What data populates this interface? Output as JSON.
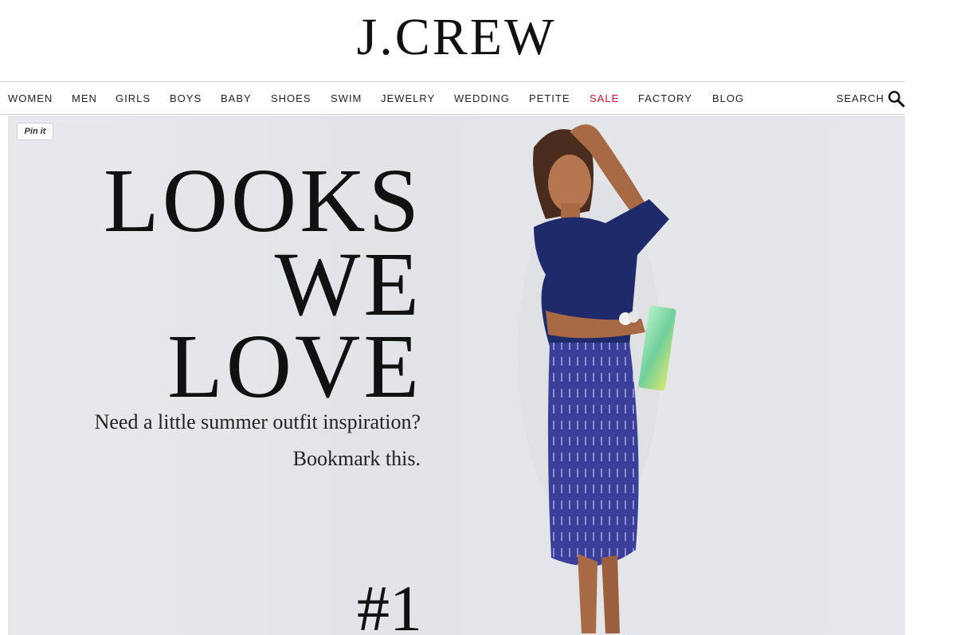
{
  "brand": {
    "logo_text": "J.CREW"
  },
  "nav": {
    "items": [
      {
        "label": "WOMEN"
      },
      {
        "label": "MEN"
      },
      {
        "label": "GIRLS"
      },
      {
        "label": "BOYS"
      },
      {
        "label": "BABY"
      },
      {
        "label": "SHOES"
      },
      {
        "label": "SWIM"
      },
      {
        "label": "JEWELRY"
      },
      {
        "label": "WEDDING"
      },
      {
        "label": "PETITE"
      },
      {
        "label": "SALE"
      },
      {
        "label": "FACTORY"
      },
      {
        "label": "BLOG"
      }
    ],
    "search_label": "SEARCH",
    "sale_color": "#d0102e"
  },
  "hero": {
    "pin_label": "Pin it",
    "headline_lines": [
      "LOOKS",
      "WE",
      "LOVE"
    ],
    "subtext_lines": [
      "Need a little summer outfit inspiration?",
      "Bookmark this."
    ],
    "number": "#1",
    "image_icon": "model-photo",
    "colors": {
      "shirt": "#1f2a6b",
      "skirt": "#3b3f9a",
      "clutch": "#7fd6a6"
    }
  }
}
